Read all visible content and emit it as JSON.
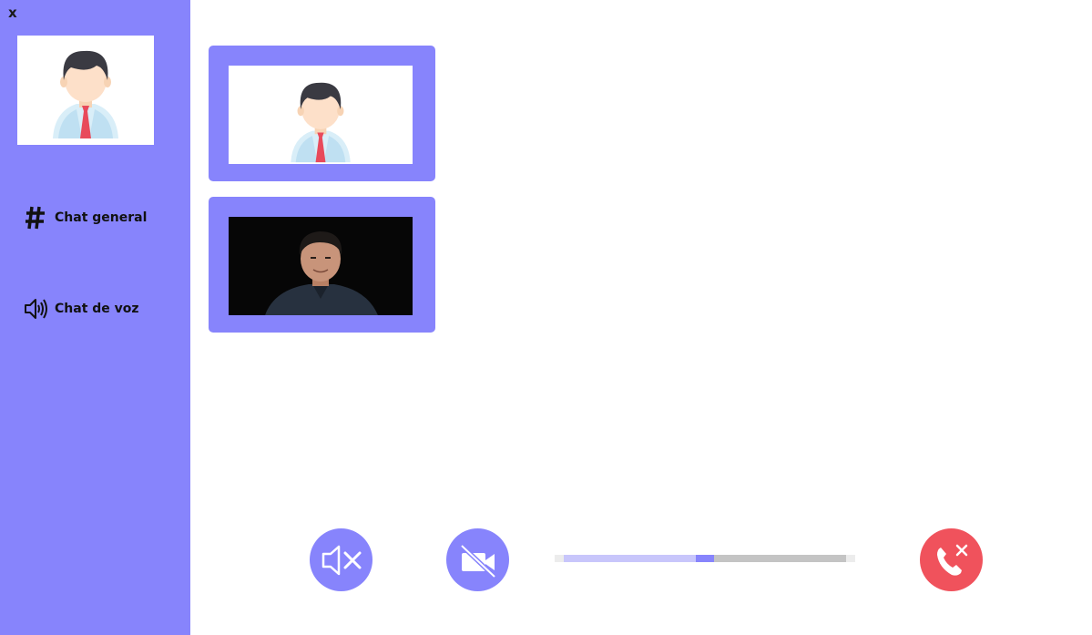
{
  "sidebar": {
    "close_label": "x",
    "nav": [
      {
        "label": "Chat general",
        "icon": "hash-icon"
      },
      {
        "label": "Chat de voz",
        "icon": "speaker-icon"
      }
    ],
    "profile_icon": "user-avatar-icon"
  },
  "tiles": [
    {
      "icon": "user-avatar-icon"
    },
    {
      "icon": "person-video-icon"
    }
  ],
  "controls": {
    "mute_icon": "speaker-muted-icon",
    "camera_icon": "camera-off-icon",
    "hangup_icon": "phone-hangup-icon",
    "volume_fraction": 0.5
  },
  "colors": {
    "accent": "#8784fc",
    "hangup": "#f0525c"
  }
}
